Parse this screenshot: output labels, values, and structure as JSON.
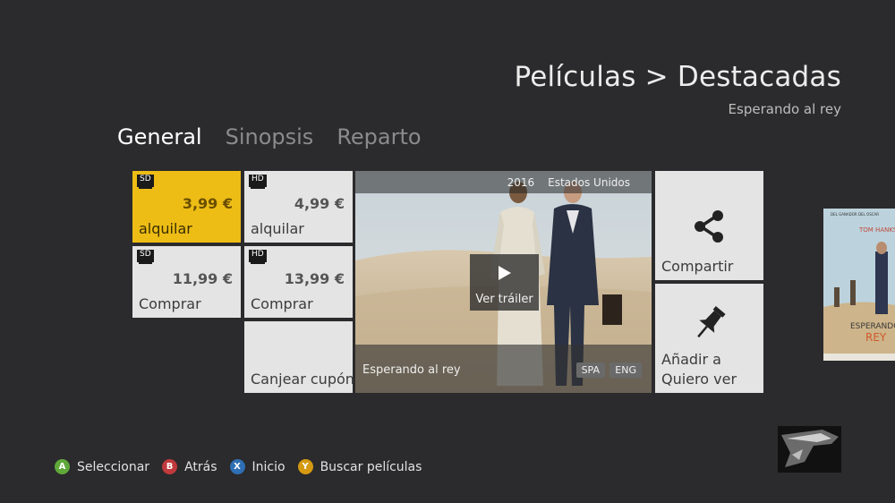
{
  "header": {
    "title": "Películas > Destacadas",
    "subtitle": "Esperando al rey"
  },
  "tabs": [
    {
      "label": "General",
      "active": true
    },
    {
      "label": "Sinopsis",
      "active": false
    },
    {
      "label": "Reparto",
      "active": false
    }
  ],
  "offers": [
    {
      "badge": "SD",
      "price": "3,99 €",
      "label": "alquilar",
      "selected": true
    },
    {
      "badge": "HD",
      "price": "4,99 €",
      "label": "alquilar",
      "selected": false
    },
    {
      "badge": "SD",
      "price": "11,99 €",
      "label": "Comprar",
      "selected": false
    },
    {
      "badge": "HD",
      "price": "13,99 €",
      "label": "Comprar",
      "selected": false
    }
  ],
  "redeem": {
    "label": "Canjear cupón"
  },
  "video": {
    "year": "2016",
    "country": "Estados Unidos",
    "play_label": "Ver tráiler",
    "title": "Esperando al rey",
    "languages": [
      "SPA",
      "ENG"
    ]
  },
  "actions": {
    "share": {
      "label": "Compartir",
      "icon": "share-icon"
    },
    "wishlist": {
      "label_line1": "Añadir a",
      "label_line2": "Quiero ver",
      "icon": "pin-icon"
    }
  },
  "poster": {
    "tagline": "DEL GANADOR DEL OSCAR",
    "actor": "TOM HANKS",
    "title_line1": "ESPERANDO",
    "title_line2": "REY"
  },
  "legend": [
    {
      "key": "A",
      "color": "#5fa83a",
      "label": "Seleccionar"
    },
    {
      "key": "B",
      "color": "#c0393c",
      "label": "Atrás"
    },
    {
      "key": "X",
      "color": "#2f6fb3",
      "label": "Inicio"
    },
    {
      "key": "Y",
      "color": "#d59a12",
      "label": "Buscar películas"
    }
  ],
  "colors": {
    "background": "#2b2a2c",
    "selected_tile": "#edbd16",
    "tile": "#e4e4e4"
  }
}
